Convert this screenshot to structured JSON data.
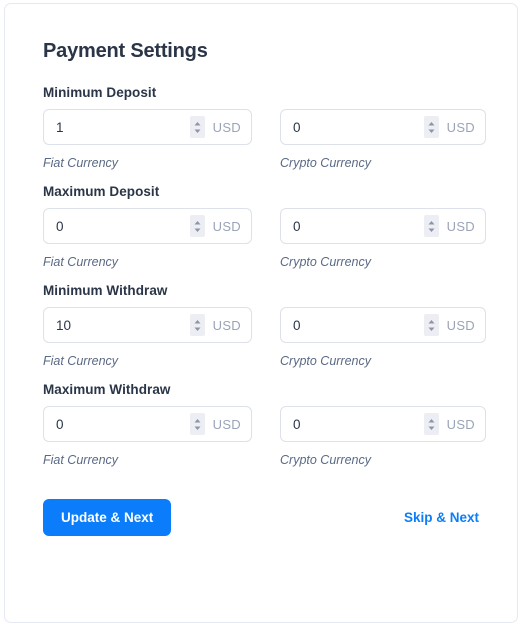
{
  "page": {
    "title": "Payment Settings"
  },
  "fields": [
    {
      "label": "Minimum Deposit",
      "fiat": {
        "value": "1",
        "suffix": "USD",
        "helper": "Fiat Currency"
      },
      "crypto": {
        "value": "0",
        "suffix": "USD",
        "helper": "Crypto Currency"
      }
    },
    {
      "label": "Maximum Deposit",
      "fiat": {
        "value": "0",
        "suffix": "USD",
        "helper": "Fiat Currency"
      },
      "crypto": {
        "value": "0",
        "suffix": "USD",
        "helper": "Crypto Currency"
      }
    },
    {
      "label": "Minimum Withdraw",
      "fiat": {
        "value": "10",
        "suffix": "USD",
        "helper": "Fiat Currency"
      },
      "crypto": {
        "value": "0",
        "suffix": "USD",
        "helper": "Crypto Currency"
      }
    },
    {
      "label": "Maximum Withdraw",
      "fiat": {
        "value": "0",
        "suffix": "USD",
        "helper": "Fiat Currency"
      },
      "crypto": {
        "value": "0",
        "suffix": "USD",
        "helper": "Crypto Currency"
      }
    }
  ],
  "actions": {
    "primary_label": "Update & Next",
    "skip_label": "Skip & Next"
  },
  "icons": {
    "stepper": "spinner-up-down-icon"
  },
  "colors": {
    "accent": "#0b7dfb",
    "heading": "#2a3547",
    "helper": "#5a6a85",
    "border": "#dde1e9",
    "card_border": "#e5e9f2",
    "suffix": "#9aa4b8"
  }
}
